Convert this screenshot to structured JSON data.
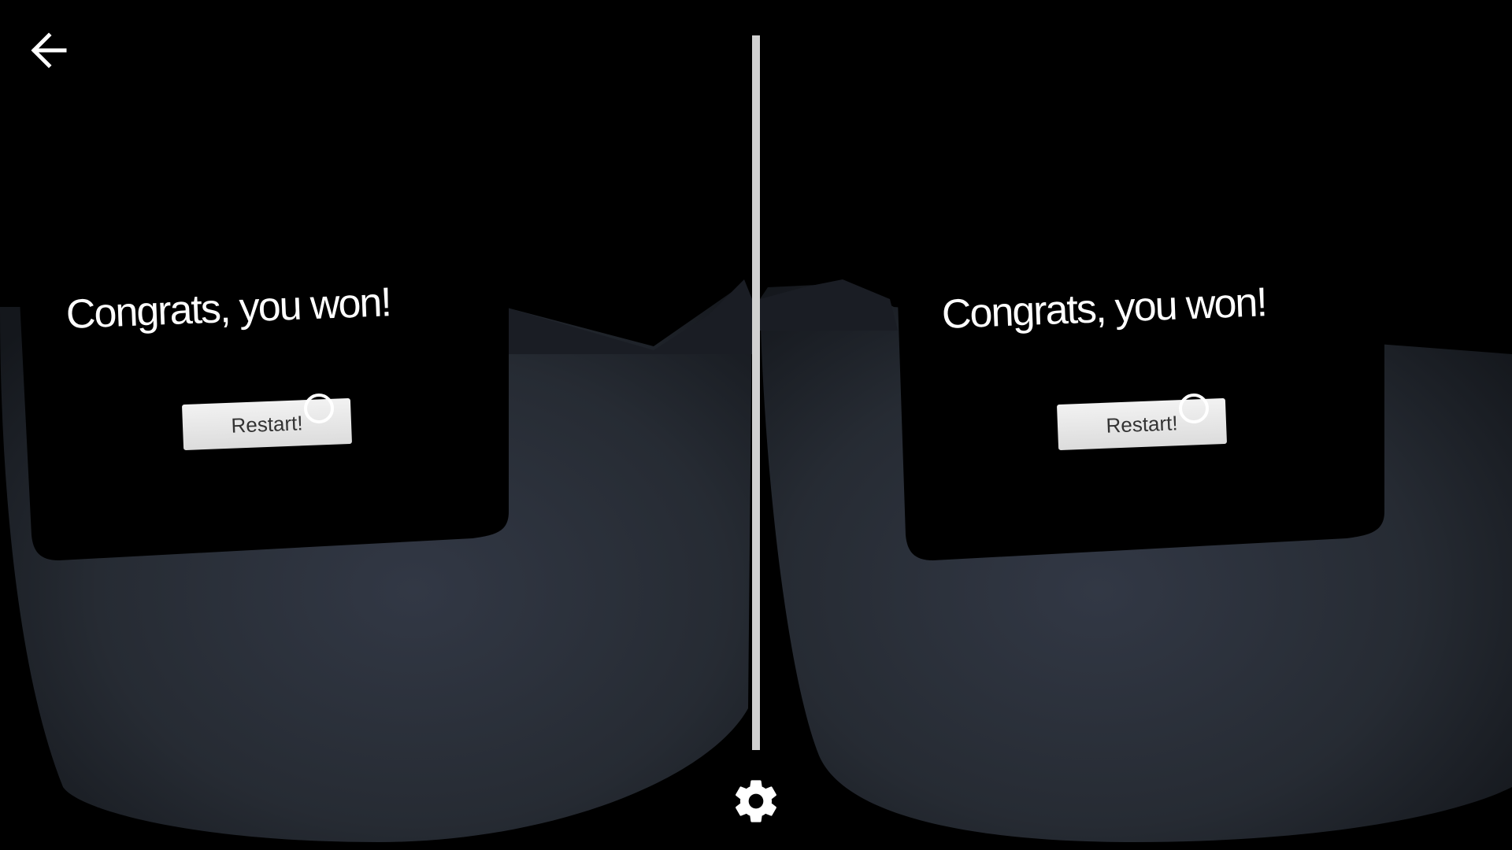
{
  "scene": {
    "left_eye": {
      "message": "Congrats, you won!",
      "restart_label": "Restart!"
    },
    "right_eye": {
      "message": "Congrats, you won!",
      "restart_label": "Restart!"
    }
  },
  "controls": {
    "back_icon": "arrow-left-icon",
    "settings_icon": "gear-icon"
  },
  "colors": {
    "background": "#000000",
    "floor": "#2a2f38",
    "panel": "#000000",
    "divider": "#d0d0d0",
    "button": "#e8e8e8",
    "reticle": "#ffffff"
  }
}
